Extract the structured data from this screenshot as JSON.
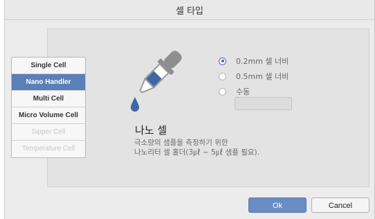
{
  "dialog": {
    "title": "셀 타입"
  },
  "cell_types": [
    {
      "label": "Single Cell",
      "state": "normal"
    },
    {
      "label": "Nano Handler",
      "state": "selected"
    },
    {
      "label": "Multi Cell",
      "state": "normal"
    },
    {
      "label": "Micro Volume Cell",
      "state": "normal"
    },
    {
      "label": "Sipper Cell",
      "state": "disabled"
    },
    {
      "label": "Temperature Cell",
      "state": "disabled"
    }
  ],
  "icon": {
    "name": "dropper-icon",
    "accent_color": "#3f67a6"
  },
  "options": {
    "radio": [
      {
        "label": "0.2mm 셀 너비",
        "checked": true
      },
      {
        "label": "0.5mm 셀 너비",
        "checked": false
      },
      {
        "label": "수동",
        "checked": false
      }
    ],
    "manual_value": ""
  },
  "detail": {
    "name": "나노 셀",
    "description_line1": "극소량의 샘플을 측정하기 위한",
    "description_line2": "나노리터 셀 홀더(3㎕ ~ 5㎕ 샘플 필요)."
  },
  "buttons": {
    "ok": "Ok",
    "cancel": "Cancel"
  },
  "colors": {
    "selected": "#5b7fb7",
    "ok_button": "#6b8dc6"
  }
}
